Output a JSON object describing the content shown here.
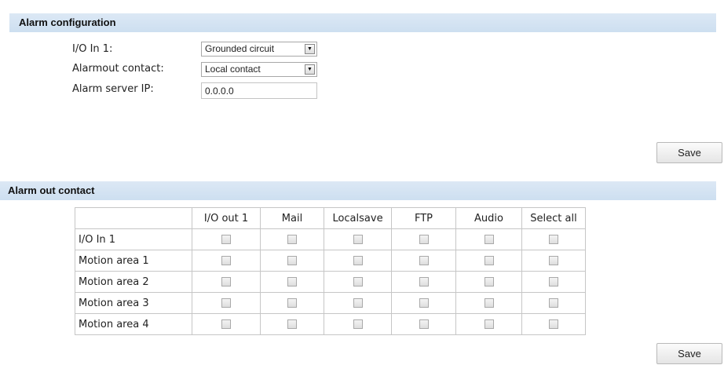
{
  "alarm_configuration": {
    "title": "Alarm configuration",
    "io_in_label": "I/O In 1:",
    "io_in_value": "Grounded circuit",
    "alarmout_label": "Alarmout contact:",
    "alarmout_value": "Local contact",
    "server_ip_label": "Alarm server IP:",
    "server_ip_value": "0.0.0.0",
    "save_label": "Save"
  },
  "alarm_out_contact": {
    "title": "Alarm out contact",
    "columns": [
      "I/O out 1",
      "Mail",
      "Localsave",
      "FTP",
      "Audio",
      "Select all"
    ],
    "rows": [
      "I/O In 1",
      "Motion area 1",
      "Motion area 2",
      "Motion area 3",
      "Motion area 4"
    ],
    "checked": [
      [
        false,
        false,
        false,
        false,
        false,
        false
      ],
      [
        false,
        false,
        false,
        false,
        false,
        false
      ],
      [
        false,
        false,
        false,
        false,
        false,
        false
      ],
      [
        false,
        false,
        false,
        false,
        false,
        false
      ],
      [
        false,
        false,
        false,
        false,
        false,
        false
      ]
    ],
    "save_label": "Save"
  },
  "icons": {
    "dropdown": "chevron-down-icon",
    "checkbox": "checkbox-unchecked"
  },
  "colors": {
    "header_bg": "#cddff0",
    "border": "#c6c6c6"
  }
}
